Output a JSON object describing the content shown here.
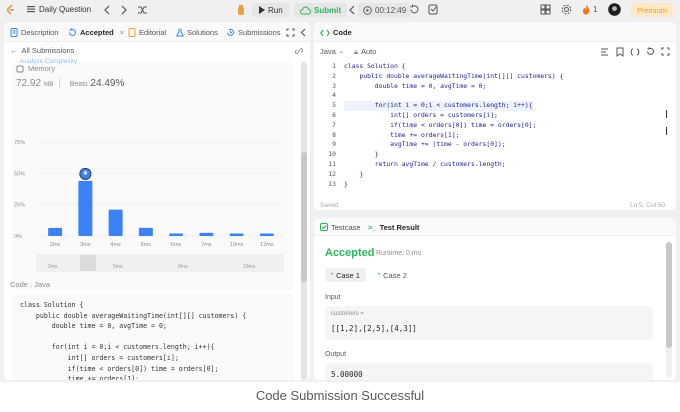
{
  "topbar": {
    "problem_list_label": "Daily Question",
    "run_label": "Run",
    "submit_label": "Submit",
    "timer": "00:12:49",
    "streak": "1",
    "premium_label": "Premium"
  },
  "left_tabs": [
    {
      "label": "Description"
    },
    {
      "label": "Accepted"
    },
    {
      "label": "Editorial"
    },
    {
      "label": "Solutions"
    },
    {
      "label": "Submissions"
    }
  ],
  "submission": {
    "all_submissions_label": "All Submissions",
    "analyze_label": "Analyze Complexity",
    "memory_title": "Memory",
    "memory_value": "72.92",
    "memory_unit": "MB",
    "beats_label": "Beats",
    "beats_pct": "24.49%",
    "code_header": "Code",
    "code_lang": "Java",
    "code_preview": "class Solution {\n    public double averageWaitingTime(int[][] customers) {\n        double time = 0, avgTime = 0;\n\n        for(int i = 0;i < customers.length; i++){\n            int[] orders = customers[i];\n            if(time < orders[0]) time = orders[0];\n            time += orders[1];"
  },
  "chart_data": {
    "type": "bar",
    "categories": [
      "2ms",
      "3ms",
      "4ms",
      "5ms",
      "6ms",
      "7ms",
      "10ms",
      "12ms"
    ],
    "values": [
      6.5,
      44,
      21,
      6.5,
      2,
      2.5,
      2,
      2
    ],
    "yticks": [
      "75%",
      "50%",
      "25%",
      "0%"
    ],
    "ylim": [
      0,
      75
    ],
    "highlight": "3ms",
    "bar_color": "#3b82f6",
    "timeline_ticks": [
      "2ms",
      "5ms",
      "8ms",
      "10ms"
    ],
    "grid": true
  },
  "editor": {
    "title": "Code",
    "language": "Java",
    "mode": "Auto",
    "line_numbers": [
      "1",
      "2",
      "3",
      "4",
      "5",
      "6",
      "7",
      "8",
      "9",
      "10",
      "11",
      "12",
      "13"
    ],
    "lines": [
      "class Solution {",
      "    public double averageWaitingTime(int[][] customers) {",
      "        double time = 0, avgTime = 0;",
      "",
      "        for(int i = 0;i < customers.length; i++){",
      "            int[] orders = customers[i];",
      "            if(time < orders[0]) time = orders[0];",
      "            time += orders[1];",
      "            avgTime += (time - orders[0]);",
      "        }",
      "        return avgTime / customers.length;",
      "    }",
      "}"
    ],
    "saved_label": "Saved",
    "cursor_pos": "Ln 5, Col 50"
  },
  "result": {
    "testcase_tab": "Testcase",
    "result_tab": "Test Result",
    "status": "Accepted",
    "runtime": "Runtime: 0 ms",
    "cases": [
      "Case 1",
      "Case 2"
    ],
    "input_label": "Input",
    "input_param": "customers =",
    "input_value": "[[1,2],[2,5],[4,3]]",
    "output_label": "Output",
    "output_value": "5.00000"
  },
  "caption": "Code Submission Successful",
  "colors": {
    "accent_green": "#2db55d",
    "bar_blue": "#3b82f6",
    "premium": "#f59e0b"
  }
}
